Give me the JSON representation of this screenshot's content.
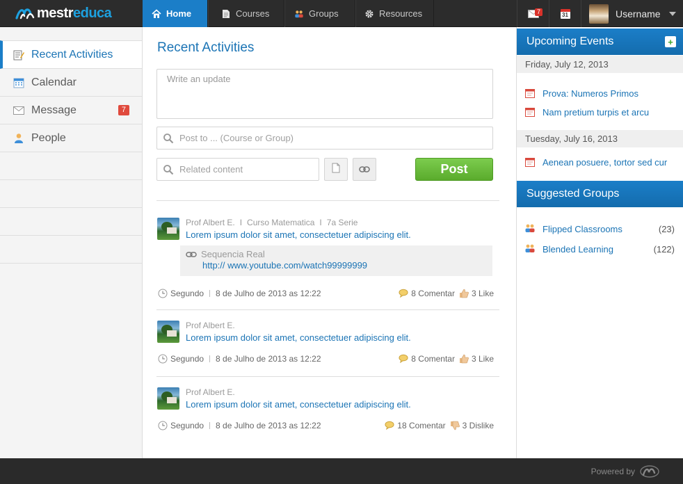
{
  "app": {
    "logo_part1": "mestr",
    "logo_part2": "educa"
  },
  "topnav": {
    "home": "Home",
    "courses": "Courses",
    "groups": "Groups",
    "resources": "Resources",
    "mail_count": "7",
    "calendar_day": "31",
    "username": "Username"
  },
  "sidebar": {
    "items": [
      {
        "label": "Recent Activities"
      },
      {
        "label": "Calendar"
      },
      {
        "label": "Message",
        "badge": "7"
      },
      {
        "label": "People"
      }
    ]
  },
  "main": {
    "title": "Recent Activities",
    "update_placeholder": "Write an update",
    "post_to_placeholder": "Post to ... (Course or Group)",
    "related_placeholder": "Related content",
    "post_button": "Post"
  },
  "feed": [
    {
      "author": "Prof Albert E.",
      "course": "Curso Matematica",
      "grade": "7a Serie",
      "text": "Lorem ipsum dolor sit amet, consectetuer adipiscing elit.",
      "link_title": "Sequencia Real",
      "link_url": "http:// www.youtube.com/watch99999999",
      "day": "Segundo",
      "date": "8 de Julho de 2013 as 12:22",
      "comments": "8 Comentar",
      "reaction": "3 Like"
    },
    {
      "author": "Prof Albert E.",
      "text": "Lorem ipsum dolor sit amet, consectetuer adipiscing elit.",
      "day": "Segundo",
      "date": "8 de Julho de 2013 as 12:22",
      "comments": "8 Comentar",
      "reaction": "3 Like"
    },
    {
      "author": "Prof Albert E.",
      "text": "Lorem ipsum dolor sit amet, consectetuer adipiscing elit.",
      "day": "Segundo",
      "date": "8 de Julho de 2013 as 12:22",
      "comments": "18 Comentar",
      "reaction": "3 Dislike"
    }
  ],
  "events": {
    "title": "Upcoming Events",
    "add_icon": "+",
    "days": [
      {
        "date": "Friday, July 12, 2013",
        "items": [
          "Prova: Numeros Primos",
          "Nam pretium turpis et arcu"
        ]
      },
      {
        "date": "Tuesday, July 16, 2013",
        "items": [
          "Aenean posuere, tortor sed cur"
        ]
      }
    ]
  },
  "groups": {
    "title": "Suggested Groups",
    "items": [
      {
        "name": "Flipped Classrooms",
        "count": "(23)"
      },
      {
        "name": "Blended Learning",
        "count": "(122)"
      }
    ]
  },
  "footer": {
    "powered_by": "Powered by"
  },
  "icons": {
    "home": "home-icon",
    "courses": "document-icon",
    "groups": "group-icon",
    "resources": "gear-icon",
    "mail": "mail-icon",
    "calendar": "calendar-icon",
    "search": "search-icon",
    "clock": "clock-icon",
    "comment": "comment-icon",
    "like": "thumbs-up-icon",
    "dislike": "thumbs-down-icon",
    "link": "link-icon"
  },
  "colors": {
    "accent": "#1b7ec8",
    "link": "#1b74b5",
    "post_button": "#6abf3d",
    "badge": "#e04a3d",
    "topbar": "#2c2c2c"
  }
}
